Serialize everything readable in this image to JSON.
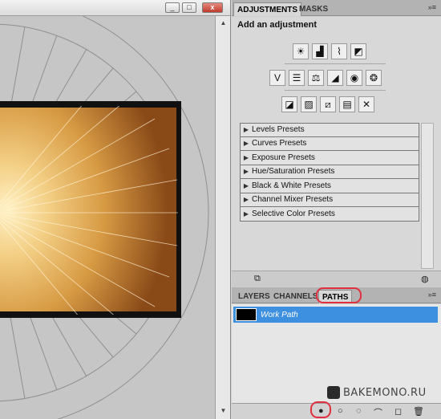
{
  "canvas_window": {
    "controls": {
      "minimize": "_",
      "maximize": "□",
      "close": "x"
    }
  },
  "adjustments_panel": {
    "tabs": [
      {
        "label": "ADJUSTMENTS",
        "active": true
      },
      {
        "label": "MASKS",
        "active": false
      }
    ],
    "menu_icon": "»≡",
    "title": "Add an adjustment",
    "icon_rows": [
      [
        "brightness-contrast-icon",
        "levels-icon",
        "curves-icon",
        "exposure-icon"
      ],
      [
        "vibrance-icon",
        "hue-saturation-icon",
        "color-balance-icon",
        "black-white-icon",
        "photo-filter-icon",
        "channel-mixer-icon"
      ],
      [
        "invert-icon",
        "posterize-icon",
        "threshold-icon",
        "gradient-map-icon",
        "selective-color-icon"
      ]
    ],
    "presets": [
      "Levels Presets",
      "Curves Presets",
      "Exposure Presets",
      "Hue/Saturation Presets",
      "Black & White Presets",
      "Channel Mixer Presets",
      "Selective Color Presets"
    ]
  },
  "paths_panel": {
    "tabs": [
      {
        "label": "LAYERS",
        "active": false
      },
      {
        "label": "CHANNELS",
        "active": false
      },
      {
        "label": "PATHS",
        "active": true
      }
    ],
    "menu_icon": "»≡",
    "items": [
      {
        "name": "Work Path",
        "selected": true
      }
    ],
    "footer_icons": [
      "fill-path-icon",
      "stroke-path-icon",
      "load-as-selection-icon",
      "make-work-path-icon",
      "new-path-icon",
      "delete-path-icon"
    ]
  },
  "watermark": {
    "text": "BAKEMONO.RU"
  },
  "colors": {
    "selection": "#3d8fe0",
    "highlight": "#e0303f"
  }
}
